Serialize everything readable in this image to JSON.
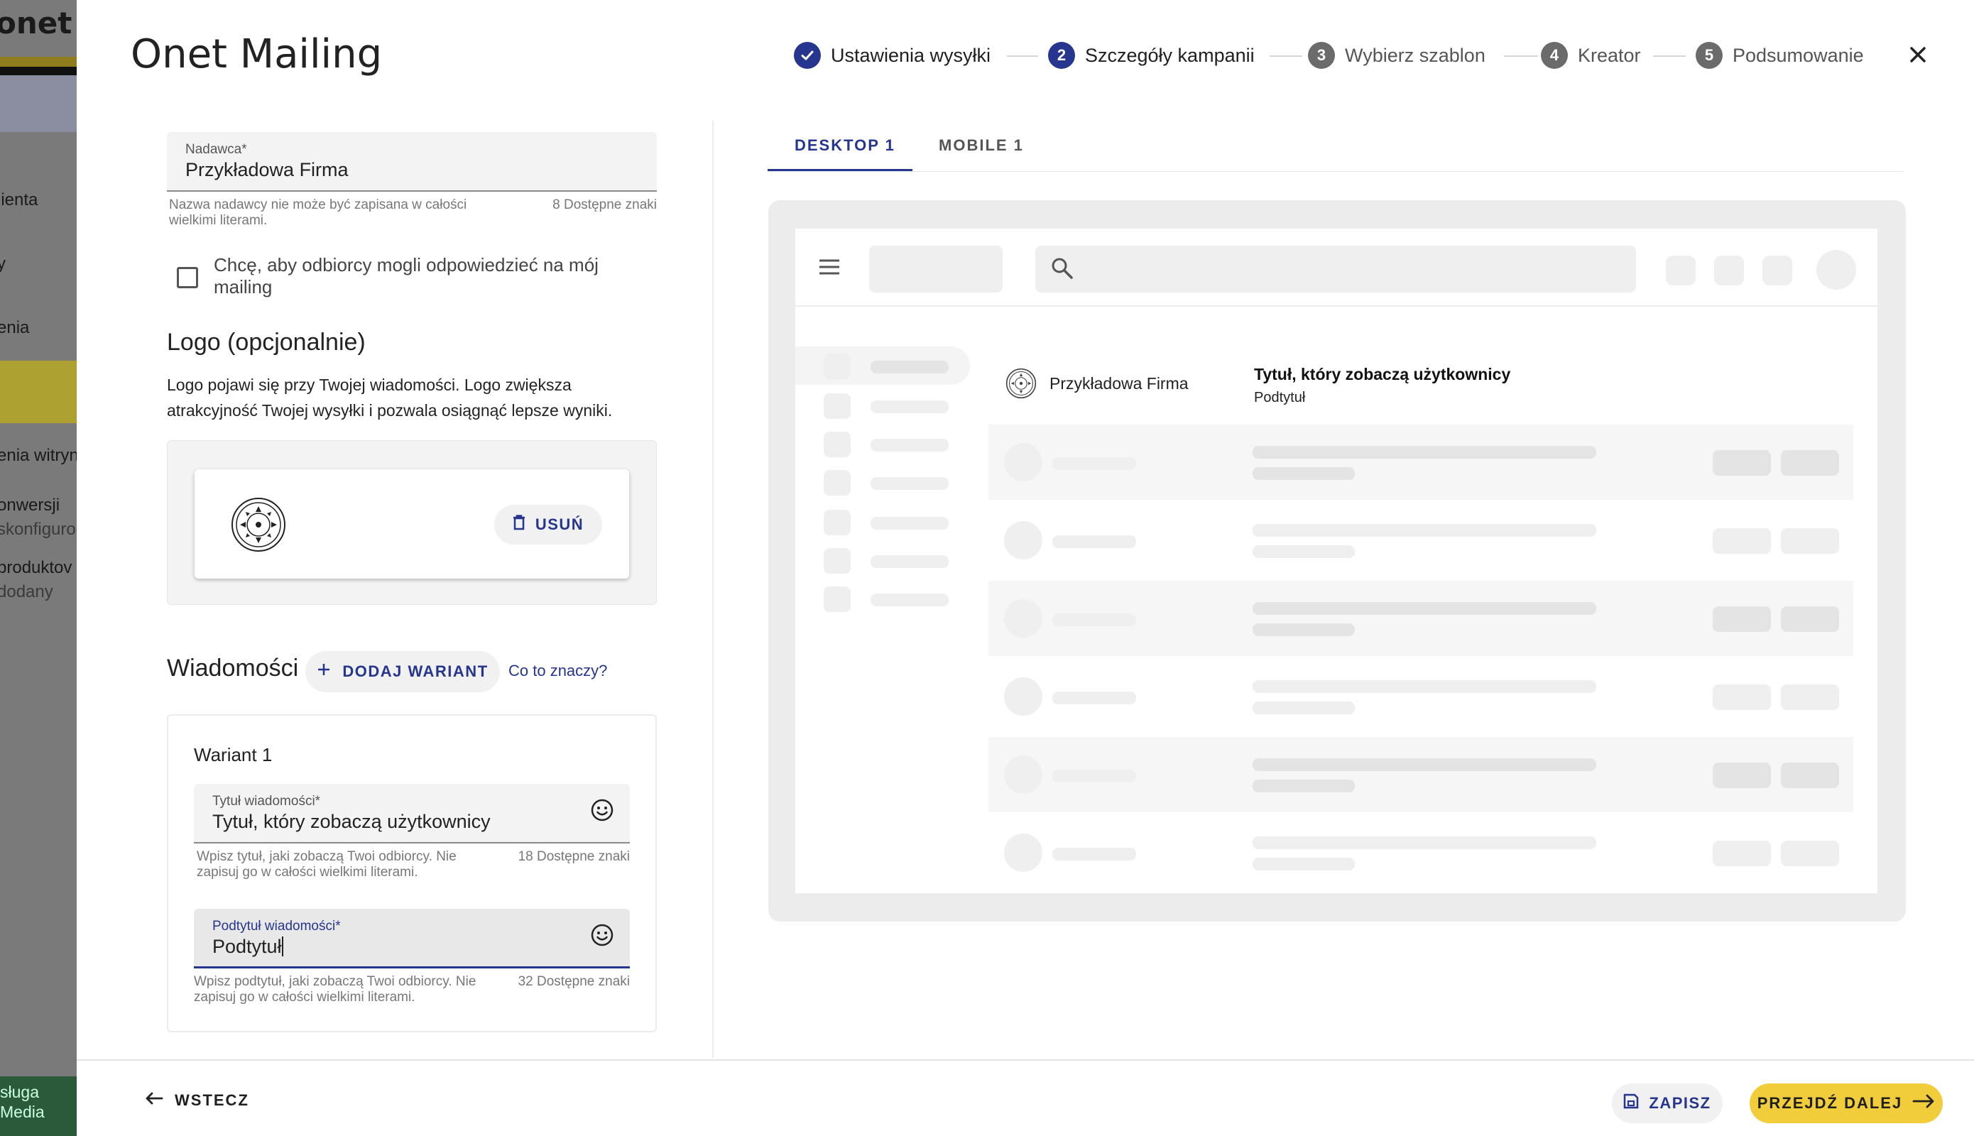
{
  "background_app": {
    "brand": "onet A",
    "nav": [
      {
        "label": "lienta"
      },
      {
        "label": "y"
      },
      {
        "label": "enia"
      },
      {
        "label": "enia witryn"
      },
      {
        "label": "onwersji",
        "sub": "skonfiguro"
      },
      {
        "label": "produktov",
        "sub": "dodany"
      }
    ],
    "footer_lines": [
      "sługa",
      "Media"
    ]
  },
  "modal": {
    "title": "Onet Mailing",
    "steps": [
      {
        "number": "✓",
        "label": "Ustawienia wysyłki",
        "state": "done"
      },
      {
        "number": "2",
        "label": "Szczegóły kampanii",
        "state": "active"
      },
      {
        "number": "3",
        "label": "Wybierz szablon",
        "state": "todo"
      },
      {
        "number": "4",
        "label": "Kreator",
        "state": "todo"
      },
      {
        "number": "5",
        "label": "Podsumowanie",
        "state": "todo"
      }
    ],
    "close_icon": "close-icon"
  },
  "form": {
    "sender": {
      "label": "Nadawca*",
      "value": "Przykładowa Firma",
      "hint": "Nazwa nadawcy nie może być zapisana w całości wielkimi literami.",
      "count": "8 Dostępne znaki"
    },
    "reply_checkbox": {
      "label": "Chcę, aby odbiorcy mogli odpowiedzieć na mój mailing",
      "checked": false
    },
    "logo": {
      "heading": "Logo (opcjonalnie)",
      "description": "Logo pojawi się przy Twojej wiadomości. Logo zwiększa atrakcyjność Twojej wysyłki i pozwala osiągnąć lepsze wyniki.",
      "remove_label": "USUŃ",
      "remove_icon": "trash-icon"
    },
    "messages": {
      "heading": "Wiadomości",
      "add_variant_label": "DODAJ WARIANT",
      "help_link": "Co to znaczy?",
      "variant": {
        "title": "Wariant 1",
        "subject": {
          "label": "Tytuł wiadomości*",
          "value": "Tytuł, który zobaczą użytkownicy",
          "hint": "Wpisz tytuł, jaki zobaczą Twoi odbiorcy. Nie zapisuj go w całości wielkimi literami.",
          "count": "18 Dostępne znaki"
        },
        "subtitle": {
          "label": "Podtytuł wiadomości*",
          "value": "Podtytuł",
          "hint": "Wpisz podtytuł, jaki zobaczą Twoi odbiorcy. Nie zapisuj go w całości wielkimi literami.",
          "count": "32 Dostępne znaki"
        }
      }
    }
  },
  "preview": {
    "tabs": [
      {
        "label": "DESKTOP 1",
        "active": true
      },
      {
        "label": "MOBILE 1",
        "active": false
      }
    ],
    "sender_name": "Przykładowa Firma",
    "subject": "Tytuł, który zobaczą użytkownicy",
    "subtitle": "Podtytuł"
  },
  "footer": {
    "back_label": "WSTECZ",
    "save_label": "ZAPISZ",
    "next_label": "PRZEJDŹ DALEJ"
  },
  "colors": {
    "accent": "#26368e",
    "primary_button": "#f2cd3b",
    "step_todo": "#6b6b6b"
  }
}
